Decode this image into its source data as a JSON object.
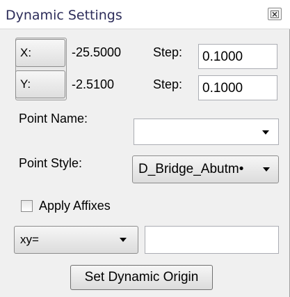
{
  "window": {
    "title": "Dynamic Settings",
    "close_icon": "close-icon"
  },
  "coords": {
    "x_label": "X:",
    "x_value": "-25.5000",
    "y_label": "Y:",
    "y_value": "-2.5100",
    "x_step_label": "Step:",
    "x_step_value": "0.1000",
    "y_step_label": "Step:",
    "y_step_value": "0.1000"
  },
  "point_name": {
    "label": "Point Name:",
    "value": ""
  },
  "point_style": {
    "label": "Point Style:",
    "value": "D_Bridge_Abutm•"
  },
  "affixes": {
    "label": "Apply Affixes",
    "checked": false,
    "format_value": "xy=",
    "text_value": ""
  },
  "actions": {
    "set_origin_label": "Set Dynamic Origin"
  }
}
